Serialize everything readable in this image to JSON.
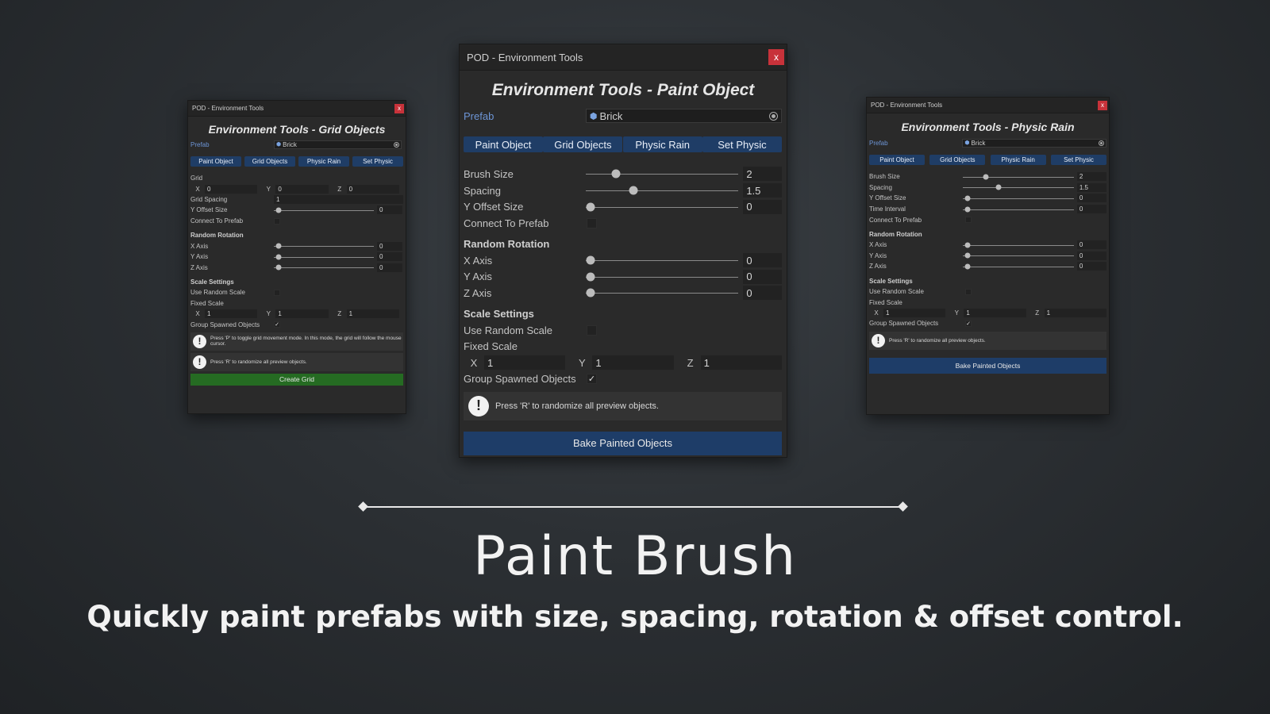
{
  "window_title": "POD - Environment Tools",
  "close_glyph": "x",
  "check_glyph": "✓",
  "prefab_label": "Prefab",
  "prefab_value": "Brick",
  "tabs": [
    "Paint Object",
    "Grid Objects",
    "Physic Rain",
    "Set Physic"
  ],
  "axis_letters": {
    "x": "X",
    "y": "Y",
    "z": "Z"
  },
  "center": {
    "heading": "Environment Tools - Paint Object",
    "brush_size": {
      "label": "Brush Size",
      "value": "2"
    },
    "spacing": {
      "label": "Spacing",
      "value": "1.5"
    },
    "y_offset": {
      "label": "Y Offset Size",
      "value": "0"
    },
    "connect_to_prefab": "Connect To Prefab",
    "random_rotation": "Random Rotation",
    "x_axis": {
      "label": "X Axis",
      "value": "0"
    },
    "y_axis": {
      "label": "Y Axis",
      "value": "0"
    },
    "z_axis": {
      "label": "Z Axis",
      "value": "0"
    },
    "scale_settings": "Scale Settings",
    "use_random_scale": "Use Random Scale",
    "fixed_scale": {
      "label": "Fixed Scale",
      "x": "1",
      "y": "1",
      "z": "1"
    },
    "group_spawned": "Group Spawned Objects",
    "help": "Press 'R' to randomize all preview objects.",
    "button": "Bake Painted Objects"
  },
  "left": {
    "heading": "Environment Tools - Grid Objects",
    "grid": {
      "label": "Grid",
      "x": "0",
      "y": "0",
      "z": "0"
    },
    "grid_spacing": {
      "label": "Grid Spacing",
      "value": "1"
    },
    "y_offset": {
      "label": "Y Offset Size",
      "value": "0"
    },
    "connect_to_prefab": "Connect To Prefab",
    "random_rotation": "Random Rotation",
    "x_axis": {
      "label": "X Axis",
      "value": "0"
    },
    "y_axis": {
      "label": "Y Axis",
      "value": "0"
    },
    "z_axis": {
      "label": "Z Axis",
      "value": "0"
    },
    "scale_settings": "Scale Settings",
    "use_random_scale": "Use Random Scale",
    "fixed_scale": {
      "label": "Fixed Scale",
      "x": "1",
      "y": "1",
      "z": "1"
    },
    "group_spawned": "Group Spawned Objects",
    "help1": "Press 'P' to toggle grid movement mode. In this mode, the grid will follow the mouse cursor.",
    "help2": "Press 'R' to randomize all preview objects.",
    "button": "Create Grid"
  },
  "right": {
    "heading": "Environment Tools - Physic Rain",
    "brush_size": {
      "label": "Brush Size",
      "value": "2"
    },
    "spacing": {
      "label": "Spacing",
      "value": "1.5"
    },
    "y_offset": {
      "label": "Y Offset Size",
      "value": "0"
    },
    "time_interval": {
      "label": "Time Interval",
      "value": "0"
    },
    "connect_to_prefab": "Connect To Prefab",
    "random_rotation": "Random Rotation",
    "x_axis": {
      "label": "X Axis",
      "value": "0"
    },
    "y_axis": {
      "label": "Y Axis",
      "value": "0"
    },
    "z_axis": {
      "label": "Z Axis",
      "value": "0"
    },
    "scale_settings": "Scale Settings",
    "use_random_scale": "Use Random Scale",
    "fixed_scale": {
      "label": "Fixed Scale",
      "x": "1",
      "y": "1",
      "z": "1"
    },
    "group_spawned": "Group Spawned Objects",
    "help": "Press 'R' to randomize all preview objects.",
    "button": "Bake Painted Objects"
  },
  "slider_fractions": {
    "brush_size": 0.18,
    "spacing": 0.3,
    "zero": 0.0
  },
  "caption": {
    "title": "Paint Brush",
    "subtitle": "Quickly paint prefabs with size, spacing, rotation & offset control."
  },
  "colors": {
    "tab_blue": "#1f3d66",
    "button_blue": "#1e3d68",
    "button_green": "#256b22",
    "close_red": "#c8323a",
    "prefab_label": "#6d95d6"
  }
}
